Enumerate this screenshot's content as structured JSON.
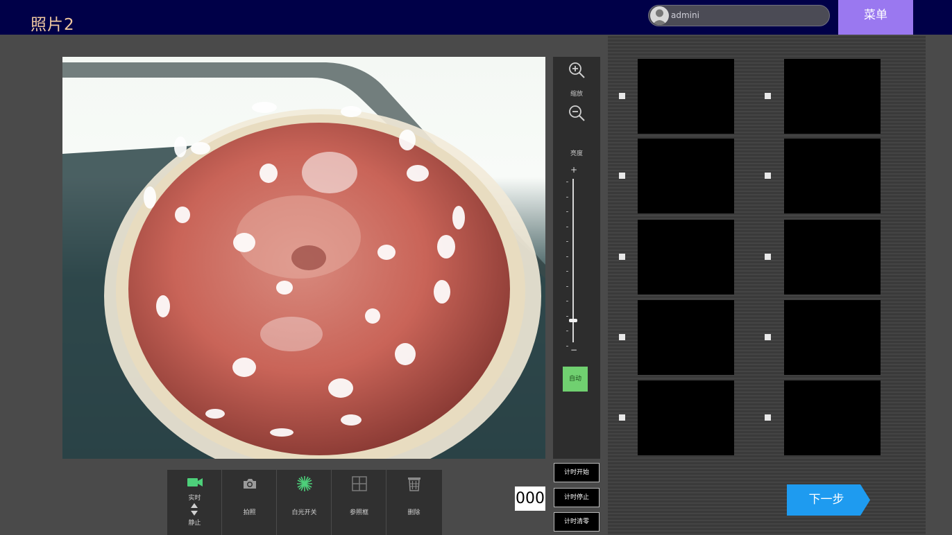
{
  "header": {
    "title": "照片2",
    "username": "admini",
    "menu_label": "菜单"
  },
  "controls": {
    "zoom_label": "缩放",
    "brightness_label": "亮度",
    "plus": "+",
    "minus": "−",
    "brightness_level": 0.13,
    "auto_label": "自动"
  },
  "timer": {
    "display": "000",
    "start_label": "计时开始",
    "stop_label": "计时停止",
    "reset_label": "计时清零"
  },
  "toolbar": {
    "live_label": "实时",
    "still_label": "静止",
    "capture_label": "拍照",
    "whitelight_label": "白光开关",
    "reference_label": "参照框",
    "delete_label": "删除"
  },
  "thumbnails": {
    "count": 10,
    "checked": [
      false,
      false,
      false,
      false,
      false,
      false,
      false,
      false,
      false,
      false
    ]
  },
  "next_label": "下一步",
  "colors": {
    "header_bg": "#000048",
    "menu_bg": "#9a78f0",
    "accent_green": "#70d070",
    "next_btn": "#1e9bf0",
    "title_color": "#f0c8a0"
  },
  "icons": {
    "avatar": "user-avatar-icon",
    "zoom_in": "zoom-in-icon",
    "zoom_out": "zoom-out-icon",
    "live": "video-camera-icon",
    "capture": "camera-icon",
    "whitelight": "starburst-icon",
    "reference": "grid-icon",
    "delete": "trash-icon"
  }
}
